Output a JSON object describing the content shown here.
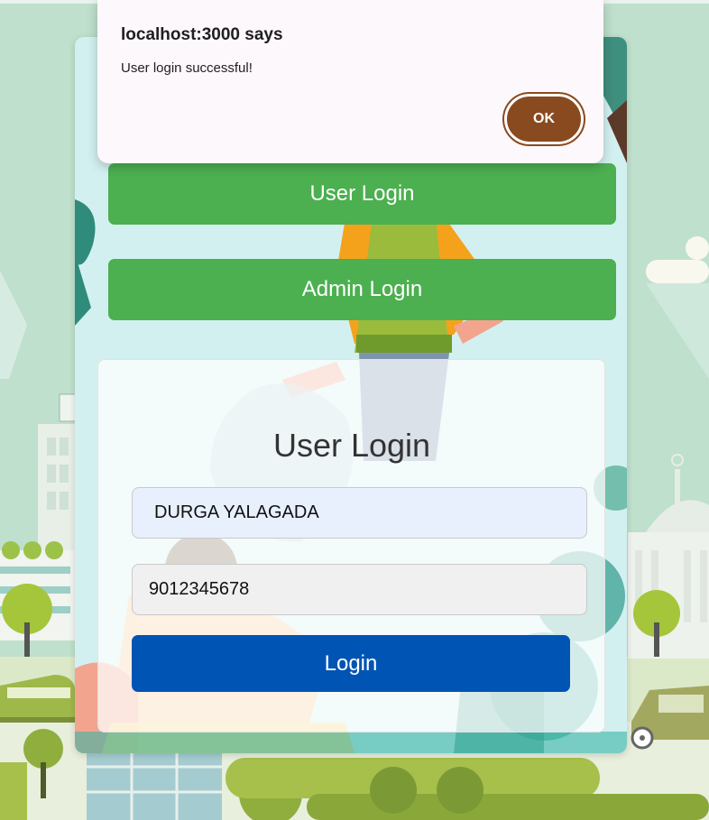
{
  "colors": {
    "green_button": "#4caf50",
    "login_button": "#0054b4",
    "ok_button": "#8a4a1f",
    "dialog_bg": "#fdf8fc",
    "name_field_bg": "#e8f0fe"
  },
  "dialog": {
    "title": "localhost:3000 says",
    "message": "User login successful!",
    "ok_label": "OK"
  },
  "nav": {
    "user_login_label": "User Login",
    "admin_login_label": "Admin Login"
  },
  "form": {
    "title": "User Login",
    "name_value": "DURGA YALAGADA",
    "mobile_value": "9012345678",
    "submit_label": "Login"
  }
}
